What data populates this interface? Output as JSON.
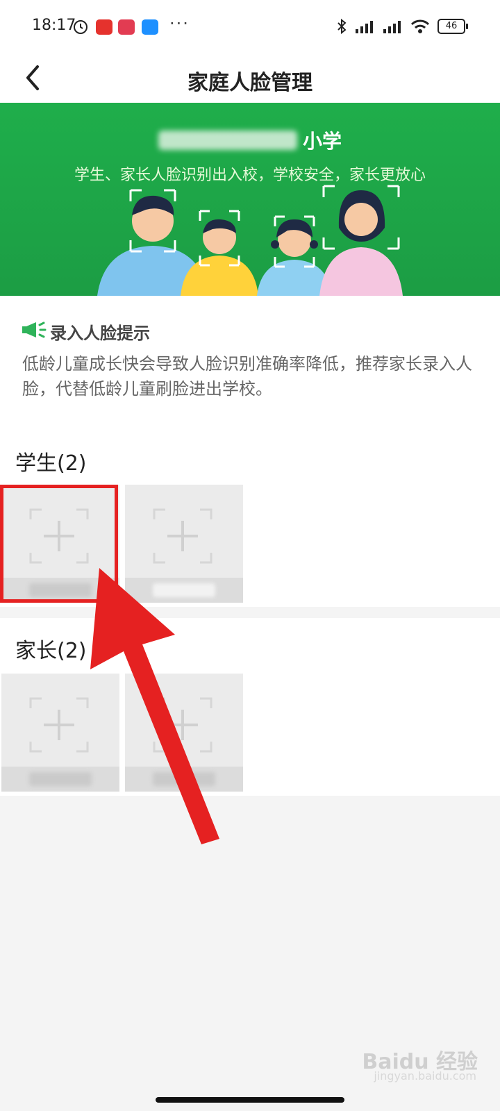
{
  "status_bar": {
    "time": "18:17",
    "battery": "46"
  },
  "header": {
    "title": "家庭人脸管理"
  },
  "banner": {
    "school_suffix": "小学",
    "slogan": "学生、家长人脸识别出入校，学校安全，家长更放心"
  },
  "tip": {
    "title": "录入人脸提示",
    "text": "低龄儿童成长快会导致人脸识别准确率降低，推荐家长录入人脸，代替低龄儿童刷脸进出学校。"
  },
  "students": {
    "title": "学生(2)"
  },
  "parents": {
    "title": "家长(2)"
  },
  "watermark": {
    "brand": "Baidu 经验",
    "url": "jingyan.baidu.com"
  },
  "colors": {
    "banner_green": "#1fae4b",
    "highlight_red": "#e52121"
  }
}
